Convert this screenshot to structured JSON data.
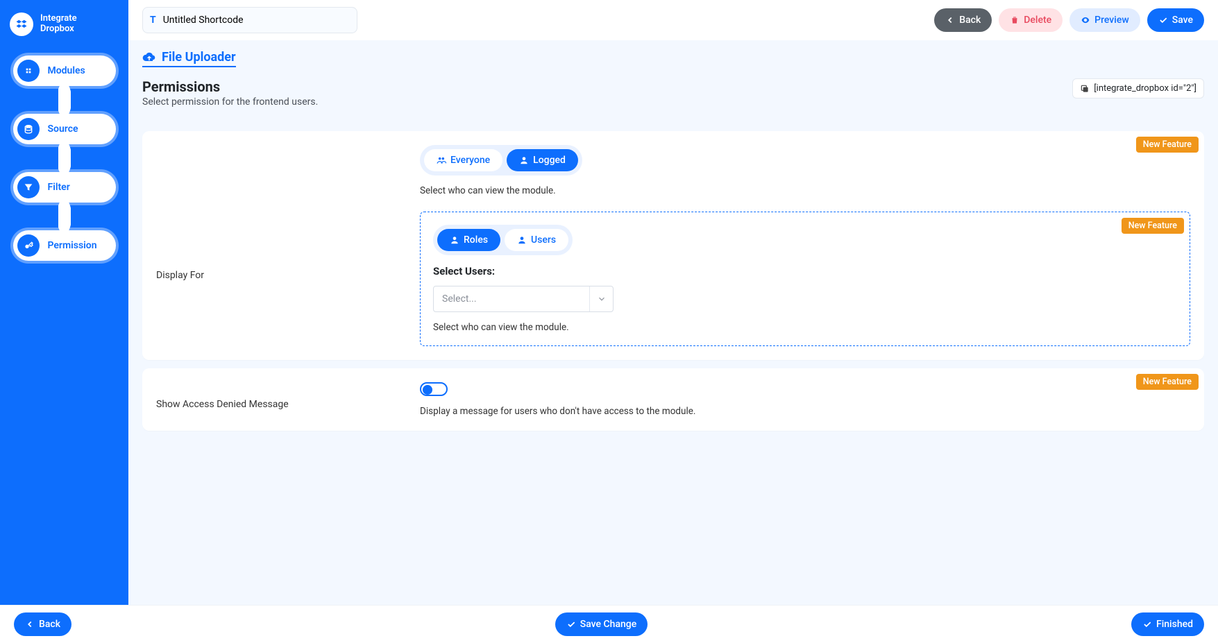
{
  "brand": {
    "line1": "Integrate",
    "line2": "Dropbox"
  },
  "sidebar": {
    "steps": [
      {
        "label": "Modules"
      },
      {
        "label": "Source"
      },
      {
        "label": "Filter"
      },
      {
        "label": "Permission"
      }
    ]
  },
  "topbar": {
    "title_value": "Untitled Shortcode",
    "back": "Back",
    "delete": "Delete",
    "preview": "Preview",
    "save": "Save"
  },
  "header": {
    "module_title": "File Uploader",
    "permissions_title": "Permissions",
    "permissions_subtitle": "Select permission for the frontend users.",
    "shortcode": "[integrate_dropbox id=\"2\"]"
  },
  "badges": {
    "new": "New Feature"
  },
  "card1": {
    "row_label": "Display For",
    "seg": {
      "everyone": "Everyone",
      "logged": "Logged"
    },
    "hint1": "Select who can view the module.",
    "nested": {
      "seg": {
        "roles": "Roles",
        "users": "Users"
      },
      "select_label": "Select Users:",
      "select_placeholder": "Select...",
      "hint": "Select who can view the module."
    }
  },
  "card2": {
    "row_label": "Show Access Denied Message",
    "hint": "Display a message for users who don't have access to the module."
  },
  "footer": {
    "back": "Back",
    "save_change": "Save Change",
    "finished": "Finished"
  }
}
